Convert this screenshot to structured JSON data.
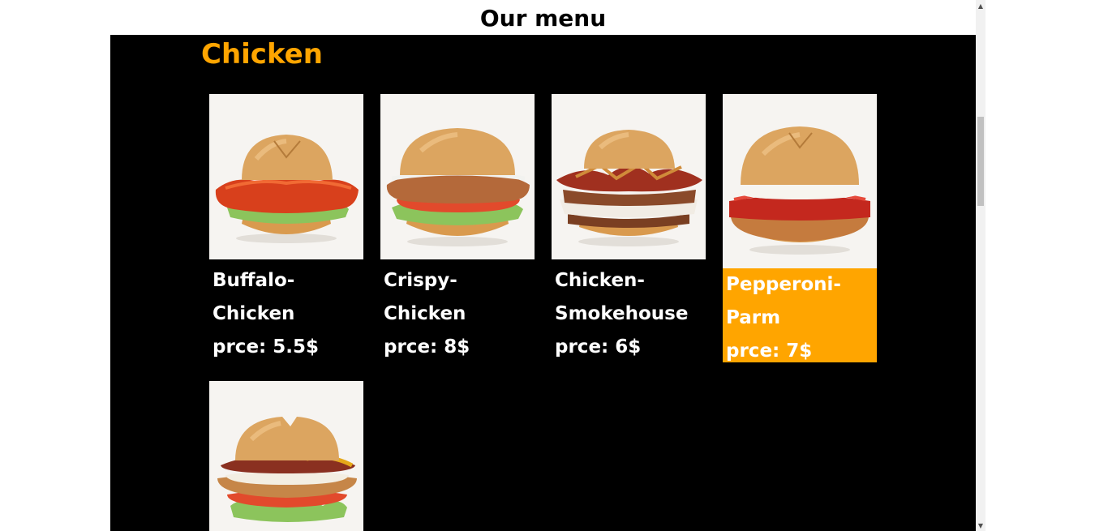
{
  "page": {
    "title": "Our menu"
  },
  "category": {
    "heading": "Chicken"
  },
  "items": [
    {
      "name": "Buffalo-Chicken",
      "price": "prce: 5.5$",
      "icon": "buffalo-chicken-sandwich-image"
    },
    {
      "name": "Crispy-Chicken",
      "price": "prce: 8$",
      "icon": "crispy-chicken-sandwich-image"
    },
    {
      "name": "Chicken-Smokehouse",
      "name_display": "Chicken- Smokehouse",
      "price": "prce: 6$",
      "icon": "chicken-smokehouse-sandwich-image"
    },
    {
      "name": "Pepperoni-Parm",
      "price": "prce: 7$",
      "icon": "pepperoni-parm-sandwich-image",
      "highlighted": true
    },
    {
      "name": "",
      "price": "",
      "icon": "chicken-bacon-sandwich-image"
    }
  ],
  "colors": {
    "accent": "#ffa500",
    "panel_background": "#000000",
    "card_text": "#ffffff",
    "photo_background": "#f6f4f1"
  }
}
